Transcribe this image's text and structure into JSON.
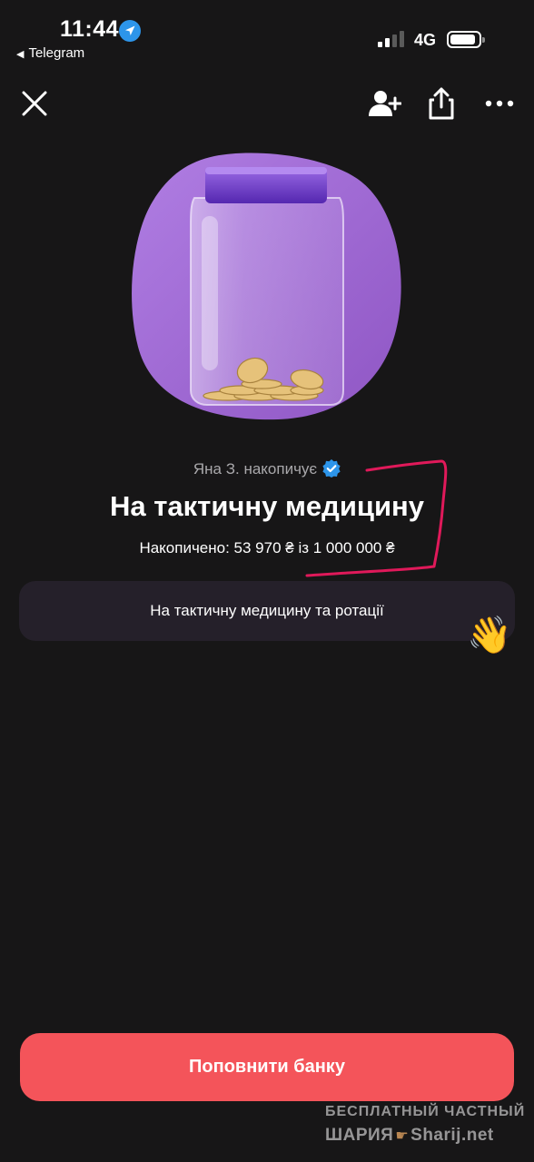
{
  "status_bar": {
    "time": "11:44",
    "back_app": "Telegram",
    "network": "4G",
    "icons": [
      "location-arrow-icon",
      "signal-icon",
      "battery-icon"
    ]
  },
  "top_bar": {
    "icons": [
      "close-icon",
      "add-user-icon",
      "share-icon",
      "more-icon"
    ]
  },
  "jar": {
    "owner_line": "Яна З. накопичує",
    "title": "На тактичну медицину",
    "accumulated": "Накопичено: 53 970 ₴ із 1 000 000 ₴",
    "collected": 53970,
    "goal": 1000000,
    "currency": "₴"
  },
  "description": {
    "text": "На тактичну медицину та ротації",
    "emoji": "👋"
  },
  "cta": {
    "label": "Поповнити банку"
  },
  "watermark": {
    "line1": "БЕСПЛАТНЫЙ  ЧАСТНЫЙ",
    "line2_left": "ШАРИЯ",
    "line2_right": "Sharij.net"
  },
  "colors": {
    "background": "#171617",
    "accent": "#f4545a",
    "bubble": "#25202a",
    "blob": "#a670d6",
    "annotation": "#e0195a"
  }
}
